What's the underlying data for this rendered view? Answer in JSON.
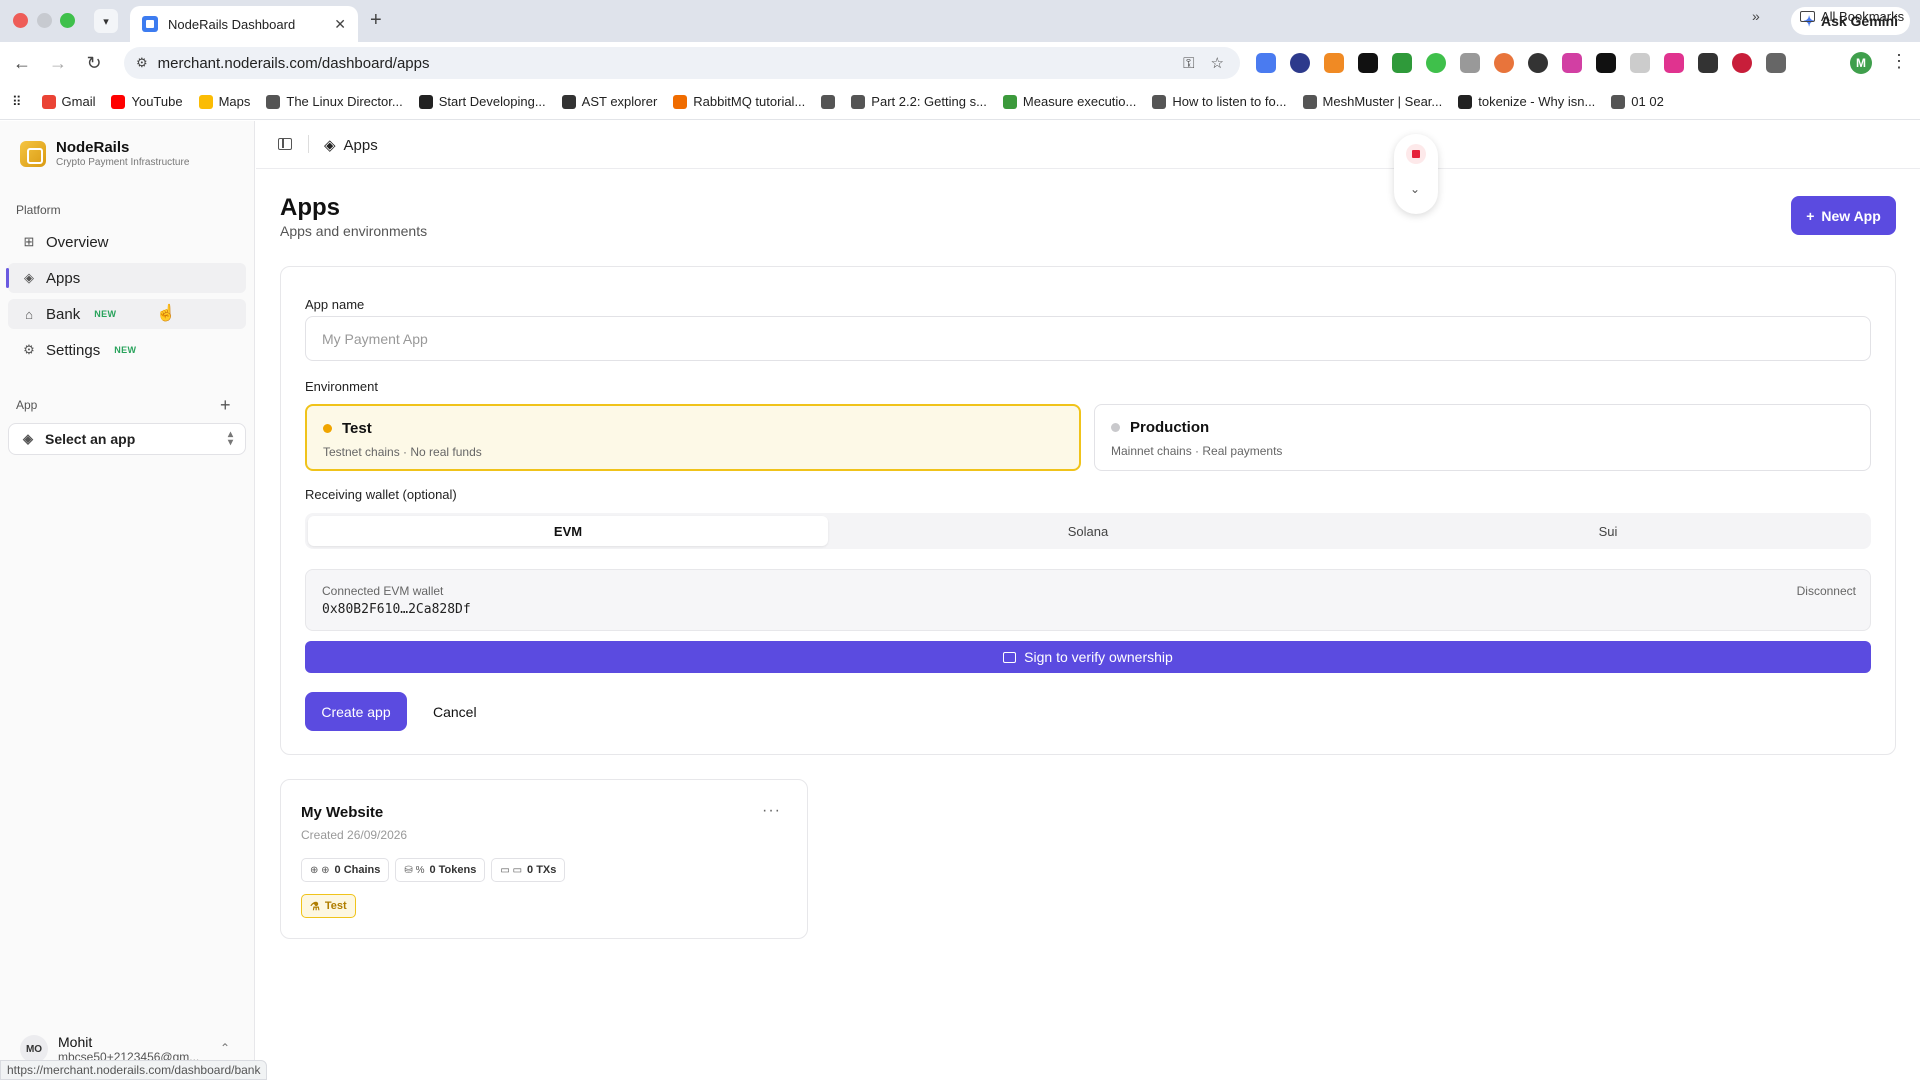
{
  "browser": {
    "tab_title": "NodeRails Dashboard",
    "url": "merchant.noderails.com/dashboard/apps",
    "ask_gemini": "Ask Gemini",
    "profile_initial": "M",
    "status_url": "https://merchant.noderails.com/dashboard/bank",
    "bookmarks": [
      {
        "label": "Gmail",
        "color": "#ea4335"
      },
      {
        "label": "YouTube",
        "color": "#ff0000"
      },
      {
        "label": "Maps",
        "color": "#fbbc04"
      },
      {
        "label": "The Linux Director...",
        "color": "#555555"
      },
      {
        "label": "Start Developing...",
        "color": "#222222"
      },
      {
        "label": "AST explorer",
        "color": "#333333"
      },
      {
        "label": "RabbitMQ tutorial...",
        "color": "#f06c00"
      },
      {
        "label": "",
        "color": "#555555"
      },
      {
        "label": "Part 2.2: Getting s...",
        "color": "#555555"
      },
      {
        "label": "Measure executio...",
        "color": "#3c9a3c"
      },
      {
        "label": "How to listen to fo...",
        "color": "#555555"
      },
      {
        "label": "MeshMuster | Sear...",
        "color": "#555555"
      },
      {
        "label": "tokenize - Why isn...",
        "color": "#222222"
      },
      {
        "label": "01 02",
        "color": "#555555"
      }
    ],
    "all_bookmarks": "All Bookmarks"
  },
  "sidebar": {
    "brand_name": "NodeRails",
    "brand_sub": "Crypto Payment Infrastructure",
    "platform_label": "Platform",
    "items": [
      {
        "label": "Overview",
        "icon": "grid-icon"
      },
      {
        "label": "Apps",
        "icon": "layers-icon"
      },
      {
        "label": "Bank",
        "icon": "bank-icon",
        "badge": "NEW"
      },
      {
        "label": "Settings",
        "icon": "gear-icon",
        "badge": "NEW"
      }
    ],
    "app_label": "App",
    "select_app": "Select an app",
    "user_initials": "MO",
    "user_name": "Mohit",
    "user_email": "mbcse50+2123456@gm..."
  },
  "main": {
    "breadcrumb": "Apps",
    "title": "Apps",
    "subtitle": "Apps and environments",
    "new_app": "New App",
    "form": {
      "app_name_label": "App name",
      "app_name_value": "",
      "app_name_placeholder": "My Payment App",
      "environment_label": "Environment",
      "environments": [
        {
          "name": "Test",
          "desc": "Testnet chains · No real funds",
          "color": "#f0a500",
          "selected": true
        },
        {
          "name": "Production",
          "desc": "Mainnet chains · Real payments",
          "color": "#c9c9cc",
          "selected": false
        }
      ],
      "wallet_label": "Receiving wallet (optional)",
      "chains": [
        "EVM",
        "Solana",
        "Sui"
      ],
      "active_chain": "EVM",
      "connected_label": "Connected EVM wallet",
      "wallet_address": "0x80B2F610…2Ca828Df",
      "disconnect": "Disconnect",
      "sign_button": "Sign to verify ownership",
      "create_button": "Create app",
      "cancel_button": "Cancel"
    },
    "apps": [
      {
        "name": "My Website",
        "created": "Created 26/09/2026",
        "chains": "0 Chains",
        "tokens": "0 Tokens",
        "txs": "0 TXs",
        "env": "Test"
      }
    ]
  },
  "colors": {
    "accent": "#5b4be0",
    "test_env": "#f0c31a"
  }
}
